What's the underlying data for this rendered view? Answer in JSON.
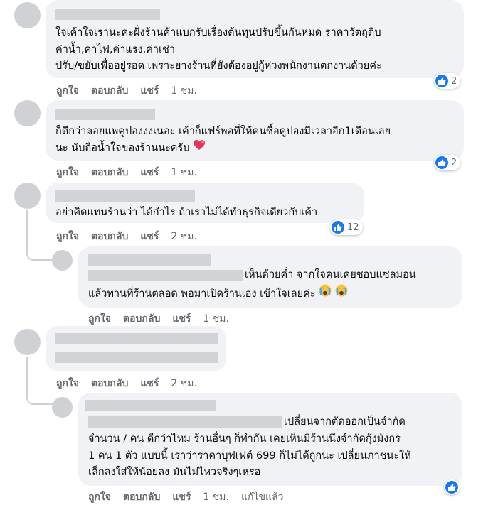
{
  "actions": {
    "like": "ถูกใจ",
    "reply": "ตอบกลับ",
    "share": "แชร์"
  },
  "comments": [
    {
      "lines": [
        "ใจเค้าใจเรานะคะฝั่งร้านค้าแบกรับเรื่องต้นทุนปรับขึ้นกันหมด ราคาวัตถุดิบ",
        "ค่าน้ำ,ค่าไฟ,ค่าแรง,ค่าเช่า",
        "ปรับ/ขยับเพื่ออยู่รอด เพราะยางร้านที่ยังต้องอยู่กู้ห่วงพนักงานตกงานด้วยค่ะ"
      ],
      "time": "1 ชม.",
      "reaction_icon": "like-icon",
      "reactions": "2"
    },
    {
      "lines": [
        "ก็ดีกว่าลอยแพคูปองงงเนอะ เค้าก็แฟร์พอที่ให้คนซื้อคูปองมีเวลาอีก1เดือนเลย",
        "นะ นับถือน้ำใจของร้านนะครับ"
      ],
      "emoji": "heart-icon",
      "time": "1 ชม.",
      "reaction_icon": "like-icon",
      "reactions": "2"
    },
    {
      "lines": [
        "อย่าคิดแทนร้านว่า ได้กำไร ถ้าเราไม่ได้ทำธุรกิจเดียวกับเค้า"
      ],
      "time": "2 ชม.",
      "reaction_icon": "like-icon",
      "reactions": "12"
    },
    {
      "lines": [
        "เห็นด้วยค่ำ จากใจคนเคยชอบแซลมอน",
        "แล้วทานที่ร้านตลอด พอมาเปิดร้านเอง เข้าใจเลยค่ะ"
      ],
      "emoji": "crying-face-icon",
      "time": "1 ชม."
    },
    {
      "lines": [],
      "time": "2 ชม."
    },
    {
      "lines": [
        "เปลี่ยนจากตัดออกเป็นจำกัด",
        "จำนวน / คน ดีกว่าไหม ร้านอื่นๆ ก็ทำกัน เคยเห็นมีร้านนึงจำกัดกุ้งมังกร",
        "1 คน 1 ตัว แบบนี้ เราว่าราคาบุฟเฟต์ 699 ก็ไม่ได้ถูกนะ เปลี่ยนภาชนะให้",
        "เล็กลงใส่ให้น้อยลง มันไม่ไหวจริงๆเหรอ"
      ],
      "time": "1 ชม.",
      "edited": "แก้ไขแล้ว",
      "reaction_icon": "like-icon"
    }
  ]
}
